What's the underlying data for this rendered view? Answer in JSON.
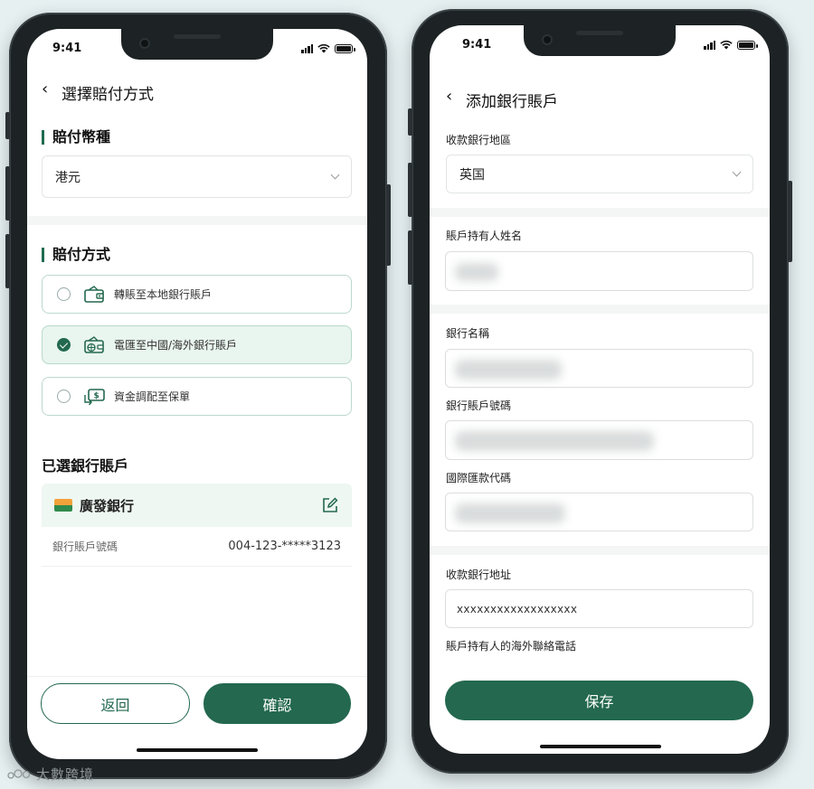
{
  "left_screen": {
    "status_time": "9:41",
    "nav_title": "選擇賠付方式",
    "currency_section_title": "賠付幣種",
    "currency_value": "港元",
    "method_section_title": "賠付方式",
    "methods": [
      {
        "label": "轉賬至本地銀行賬戶",
        "selected": false,
        "icon": "wallet-icon"
      },
      {
        "label": "電匯至中國/海外銀行賬戶",
        "selected": true,
        "icon": "wallet-globe-icon"
      },
      {
        "label": "資金調配至保單",
        "selected": false,
        "icon": "money-transfer-icon"
      }
    ],
    "selected_account_title": "已選銀行賬戶",
    "bank_name": "廣發銀行",
    "account_number_label": "銀行賬戶號碼",
    "account_number_value": "004-123-*****3123",
    "back_button": "返回",
    "confirm_button": "確認"
  },
  "right_screen": {
    "status_time": "9:41",
    "nav_title": "添加銀行賬戶",
    "region_label": "收款銀行地區",
    "region_value": "英国",
    "holder_name_label": "賬戶持有人姓名",
    "bank_name_label": "銀行名稱",
    "account_number_label": "銀行賬戶號碼",
    "swift_label": "國際匯款代碼",
    "bank_address_label": "收款銀行地址",
    "bank_address_value": "xxxxxxxxxxxxxxxxxx",
    "overseas_phone_label": "賬戶持有人的海外聯絡電話",
    "save_button": "保存"
  },
  "watermark": "大數跨境",
  "colors": {
    "primary_green": "#23684f",
    "selected_option_bg": "#e9f5ef",
    "background": "#e6f0f1"
  }
}
